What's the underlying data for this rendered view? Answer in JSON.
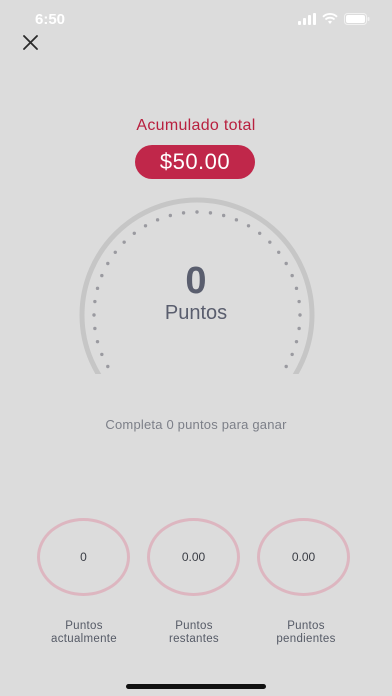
{
  "status_bar": {
    "time": "6:50"
  },
  "header": {
    "close_icon": "close-icon"
  },
  "summary": {
    "title": "Acumulado total",
    "amount": "$50.00"
  },
  "gauge": {
    "value": "0",
    "unit": "Puntos",
    "progress": 0
  },
  "info_text": "Completa 0 puntos para ganar",
  "stats": [
    {
      "value": "0",
      "label_line1": "Puntos",
      "label_line2": "actualmente"
    },
    {
      "value": "0.00",
      "label_line1": "Puntos",
      "label_line2": "restantes"
    },
    {
      "value": "0.00",
      "label_line1": "Puntos",
      "label_line2": "pendientes"
    }
  ],
  "colors": {
    "accent": "#c0274a",
    "background": "#dcdcdc",
    "circle_border": "#ddb6c0",
    "gauge_arc": "#c6c6c6"
  }
}
